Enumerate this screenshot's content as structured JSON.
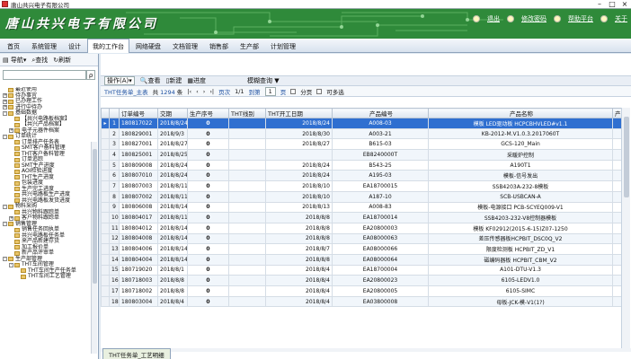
{
  "window": {
    "title": "唐山共兴电子有限公司",
    "controls": [
      "minimize-icon",
      "maximize-icon",
      "close-icon"
    ]
  },
  "banner": {
    "brand": "唐山共兴电子有限公司",
    "links": [
      "退出",
      "修改密码",
      "帮助平台",
      "关于"
    ]
  },
  "menu": {
    "tabs": [
      "首页",
      "系统管理",
      "设计",
      "我的工作台",
      "网络硬盘",
      "文档管理",
      "销售部",
      "生产部",
      "计划管理"
    ],
    "active": "我的工作台"
  },
  "sidebar": {
    "toolbar": {
      "nav_label": "导航",
      "search_label": "查找",
      "refresh_label": "刷新"
    },
    "search_button": "ρ",
    "tree": [
      {
        "level": 0,
        "pm": "",
        "label": "最近使用"
      },
      {
        "level": 0,
        "pm": "+",
        "label": "待办事宜"
      },
      {
        "level": 0,
        "pm": "+",
        "label": "已办理工作"
      },
      {
        "level": 0,
        "pm": "+",
        "label": "进行中待办"
      },
      {
        "level": 0,
        "pm": "-",
        "label": "基础数据"
      },
      {
        "level": 1,
        "pm": "",
        "label": "【共兴电路板档案】"
      },
      {
        "level": 1,
        "pm": "",
        "label": "【共兴产品档案】"
      },
      {
        "level": 1,
        "pm": "+",
        "label": "电子元器件档案"
      },
      {
        "level": 0,
        "pm": "-",
        "label": "订单统计"
      },
      {
        "level": 1,
        "pm": "",
        "label": "订单排产任务表"
      },
      {
        "level": 1,
        "pm": "",
        "label": "SMT客户备料管理"
      },
      {
        "level": 1,
        "pm": "",
        "label": "THT客户备料管理"
      },
      {
        "level": 1,
        "pm": "",
        "label": "订单追踪"
      },
      {
        "level": 1,
        "pm": "",
        "label": "SMT生产进度"
      },
      {
        "level": 1,
        "pm": "",
        "label": "AOI检验进度"
      },
      {
        "level": 1,
        "pm": "",
        "label": "THT生产进度"
      },
      {
        "level": 1,
        "pm": "",
        "label": "包装进度"
      },
      {
        "level": 1,
        "pm": "",
        "label": "生产完工进度"
      },
      {
        "level": 1,
        "pm": "",
        "label": "共兴电路板生产进度"
      },
      {
        "level": 1,
        "pm": "",
        "label": "共兴电路板发货进度"
      },
      {
        "level": 0,
        "pm": "-",
        "label": "物料采购"
      },
      {
        "level": 1,
        "pm": "",
        "label": "共兴物料跟踪单"
      },
      {
        "level": 1,
        "pm": "+",
        "label": "客户物料跟踪单"
      },
      {
        "level": 0,
        "pm": "-",
        "label": "销售管理"
      },
      {
        "level": 1,
        "pm": "",
        "label": "销售任务回执单"
      },
      {
        "level": 1,
        "pm": "",
        "label": "共兴电路板任务单"
      },
      {
        "level": 1,
        "pm": "",
        "label": "来产品新建存货"
      },
      {
        "level": 1,
        "pm": "",
        "label": "加工报价单"
      },
      {
        "level": 1,
        "pm": "",
        "label": "新产品评审单"
      },
      {
        "level": 0,
        "pm": "-",
        "label": "生产部管理"
      },
      {
        "level": 1,
        "pm": "-",
        "label": "THT车间管理"
      },
      {
        "level": 2,
        "pm": "",
        "label": "THT车间生产任务单"
      },
      {
        "level": 2,
        "pm": "",
        "label": "THT车间工艺管理"
      }
    ]
  },
  "toolbar": {
    "operation": "操作(A)",
    "view": "查看",
    "new": "新建",
    "progress": "进度",
    "query_mode": "模糊查询"
  },
  "pager": {
    "title": "THT任务单_主表",
    "total_prefix": "共",
    "total": "1294",
    "total_suffix": "条",
    "page_label": "页次",
    "page": "1/1",
    "goto": "到第",
    "page_input": "1",
    "page_suffix": "页",
    "split_label": "分页",
    "multi_label": "可多选"
  },
  "table": {
    "headers": [
      "订单编号",
      "交期",
      "生产序号",
      "THT线别",
      "THT开工日期",
      "产品编号",
      "产品名称",
      "产"
    ],
    "rows": [
      {
        "n": "1",
        "code": "180817022",
        "date": "2018/8/24",
        "seq": "0",
        "line": "",
        "start": "2018/8/24",
        "pid": "A008-03",
        "name": "模板 LED驱动板 HCPCBHVLED#v1.1",
        "selected": true
      },
      {
        "n": "2",
        "code": "180829001",
        "date": "2018/9/3",
        "seq": "0",
        "line": "",
        "start": "2018/8/30",
        "pid": "A003-21",
        "name": "KB-2012-M.V1.0.3.2017060T"
      },
      {
        "n": "3",
        "code": "180827001",
        "date": "2018/8/27",
        "seq": "0",
        "line": "",
        "start": "2018/8/27",
        "pid": "B615-03",
        "name": "GCS-120_Main"
      },
      {
        "n": "4",
        "code": "180825001",
        "date": "2018/8/25",
        "seq": "0",
        "line": "",
        "start": "",
        "pid": "EB8240000T",
        "name": "采暖炉控制"
      },
      {
        "n": "5",
        "code": "180809008",
        "date": "2018/8/24",
        "seq": "0",
        "line": "",
        "start": "2018/8/24",
        "pid": "B543-25",
        "name": "A190T1"
      },
      {
        "n": "6",
        "code": "180807010",
        "date": "2018/8/24",
        "seq": "0",
        "line": "",
        "start": "2018/8/24",
        "pid": "A195-03",
        "name": "模板-信号发出"
      },
      {
        "n": "7",
        "code": "180807003",
        "date": "2018/8/11",
        "seq": "0",
        "line": "",
        "start": "2018/8/10",
        "pid": "EA18700015",
        "name": "SSB4203A-232-8模板"
      },
      {
        "n": "8",
        "code": "180807002",
        "date": "2018/8/11",
        "seq": "0",
        "line": "",
        "start": "2018/8/10",
        "pid": "A187-10",
        "name": "SCB-USBCAN-A"
      },
      {
        "n": "9",
        "code": "180806008",
        "date": "2018/8/14",
        "seq": "0",
        "line": "",
        "start": "2018/8/13",
        "pid": "A008-83",
        "name": "模板-电源接口 PCB-SCYEQ009-V1"
      },
      {
        "n": "10",
        "code": "180804017",
        "date": "2018/8/11",
        "seq": "0",
        "line": "",
        "start": "2018/8/8",
        "pid": "EA18700014",
        "name": "SSB4203-232-V8控制器模板"
      },
      {
        "n": "11",
        "code": "180804012",
        "date": "2018/8/14",
        "seq": "0",
        "line": "",
        "start": "2018/8/8",
        "pid": "EA20800003",
        "name": "模板 KF02912(2015-6-15)Z07-1250"
      },
      {
        "n": "12",
        "code": "180804008",
        "date": "2018/8/14",
        "seq": "0",
        "line": "",
        "start": "2018/8/8",
        "pid": "EA08000063",
        "name": "差压传感器板HCPBIT_DSC0Q_V2"
      },
      {
        "n": "13",
        "code": "180804006",
        "date": "2018/8/14",
        "seq": "0",
        "line": "",
        "start": "2018/8/7",
        "pid": "EA08000066",
        "name": "限度检测板 HCPBIT_ZD_V1"
      },
      {
        "n": "14",
        "code": "180804004",
        "date": "2018/8/14",
        "seq": "0",
        "line": "",
        "start": "2018/8/8",
        "pid": "EA08000064",
        "name": "磁编码器板 HCPBIT_CBM_V2"
      },
      {
        "n": "15",
        "code": "180719020",
        "date": "2018/8/1",
        "seq": "0",
        "line": "",
        "start": "2018/8/4",
        "pid": "EA18700004",
        "name": "A101-DTU-V1.3"
      },
      {
        "n": "16",
        "code": "180718003",
        "date": "2018/8/8",
        "seq": "0",
        "line": "",
        "start": "2018/8/4",
        "pid": "EA20800023",
        "name": "6105-LEDV1.0"
      },
      {
        "n": "17",
        "code": "180718002",
        "date": "2018/8/8",
        "seq": "0",
        "line": "",
        "start": "2018/8/4",
        "pid": "EA20800005",
        "name": "6105-SIMC"
      },
      {
        "n": "18",
        "code": "180803004",
        "date": "2018/8/4",
        "seq": "0",
        "line": "",
        "start": "2018/8/4",
        "pid": "EA03800008",
        "name": "母板-JCK-模-V1(1?)"
      }
    ]
  },
  "bottom_tab": "THT任务单_工艺明细",
  "colors": {
    "banner": "#2f8a3a",
    "selected_row": "#2f6fd0",
    "accent": "#1b4ea0"
  }
}
